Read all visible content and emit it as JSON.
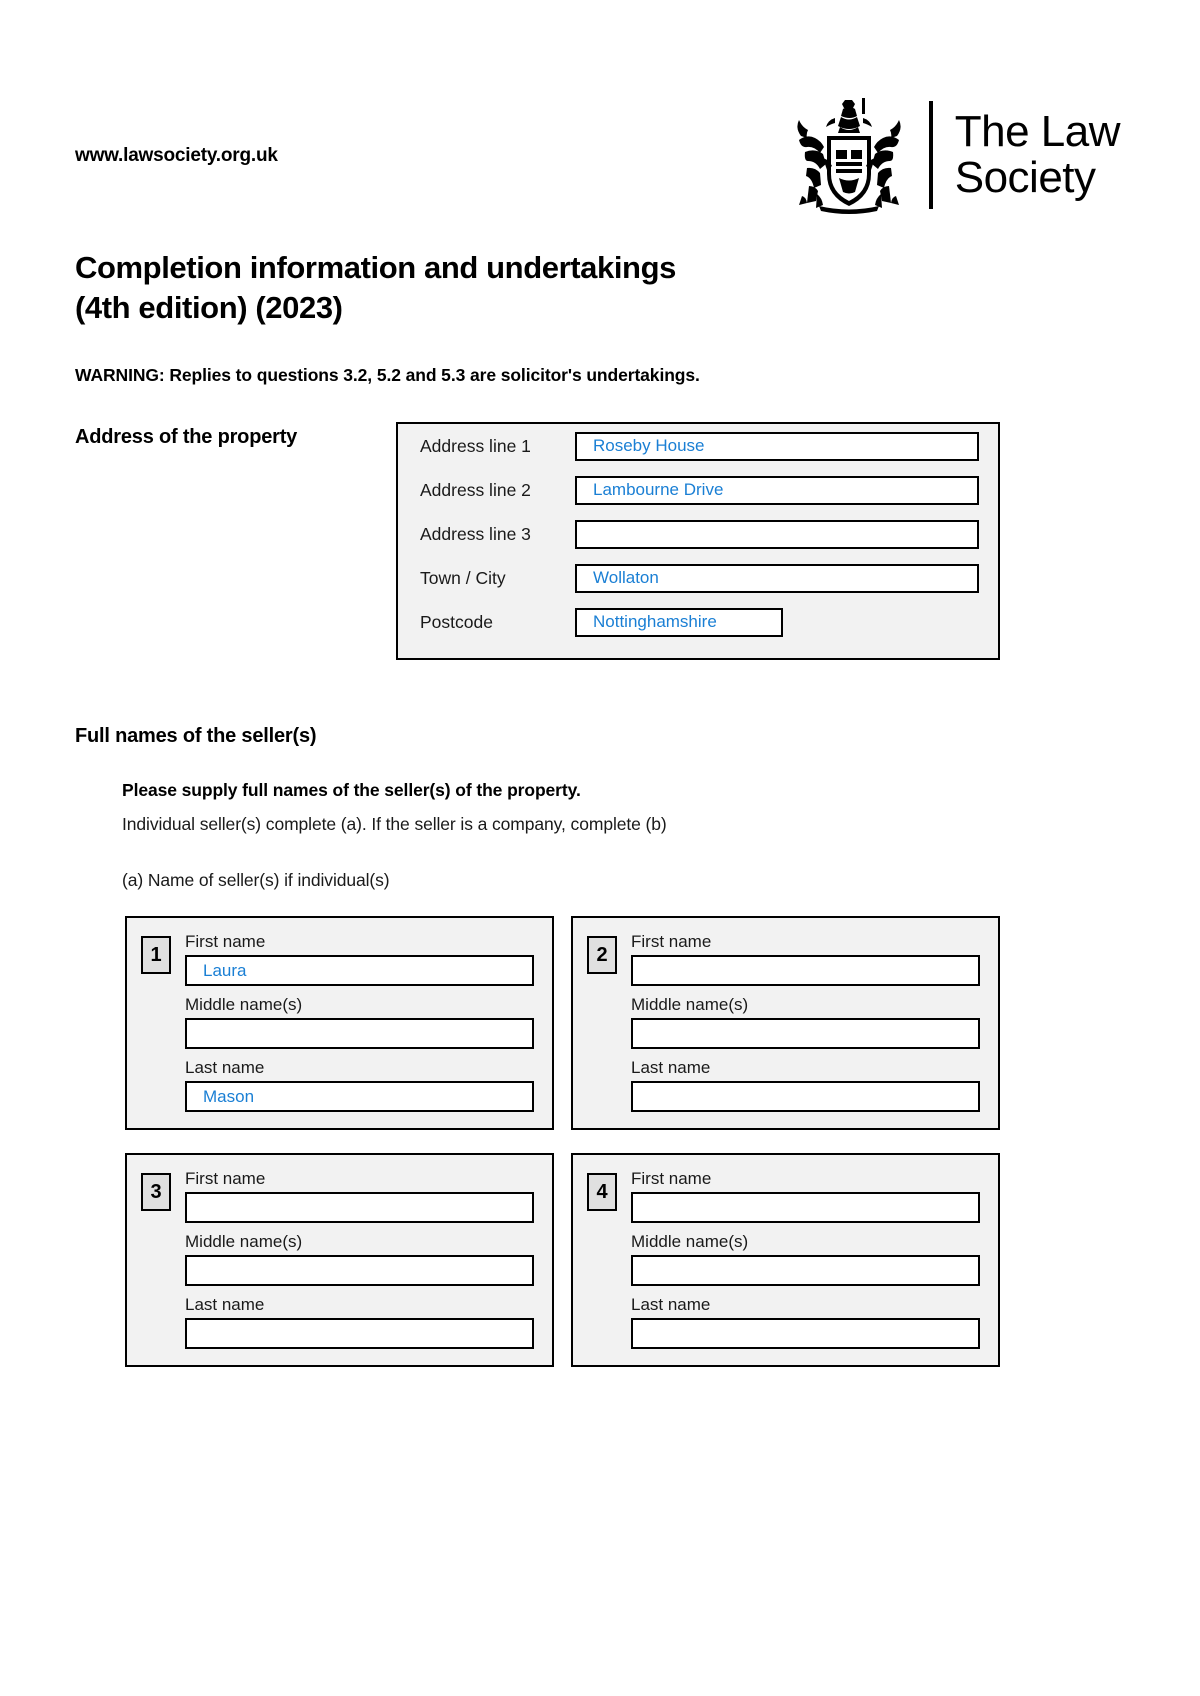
{
  "header": {
    "site_url": "www.lawsociety.org.uk",
    "brand_name": "The Law\nSociety",
    "crest_icon": "law-society-coat-of-arms"
  },
  "document": {
    "title": "Completion information and undertakings\n(4th edition) (2023)",
    "warning": "WARNING: Replies to questions 3.2, 5.2 and 5.3 are solicitor's undertakings."
  },
  "address_section": {
    "heading": "Address of the property",
    "rows": [
      {
        "label": "Address line 1",
        "value": "Roseby House",
        "width": "wide"
      },
      {
        "label": "Address line 2",
        "value": "Lambourne Drive",
        "width": "wide"
      },
      {
        "label": "Address line 3",
        "value": "",
        "width": "wide"
      },
      {
        "label": "Town / City",
        "value": "Wollaton",
        "width": "wide"
      },
      {
        "label": "Postcode",
        "value": "Nottinghamshire",
        "width": "narrow"
      }
    ]
  },
  "sellers_section": {
    "heading": "Full names of the seller(s)",
    "instruction_bold": "Please supply full names of the seller(s) of the property.",
    "instruction": "Individual seller(s) complete (a). If the seller is a company, complete (b)",
    "subheading": "(a) Name of seller(s) if individual(s)",
    "field_labels": {
      "first": "First name",
      "middle": "Middle name(s)",
      "last": "Last name"
    },
    "entries": [
      {
        "number": "1",
        "first_name": "Laura",
        "middle_names": "",
        "last_name": "Mason"
      },
      {
        "number": "2",
        "first_name": "",
        "middle_names": "",
        "last_name": ""
      },
      {
        "number": "3",
        "first_name": "",
        "middle_names": "",
        "last_name": ""
      },
      {
        "number": "4",
        "first_name": "",
        "middle_names": "",
        "last_name": ""
      }
    ]
  },
  "colors": {
    "filled_text": "#1a7fd4",
    "panel_background": "#f2f2f2",
    "border": "#000000"
  }
}
